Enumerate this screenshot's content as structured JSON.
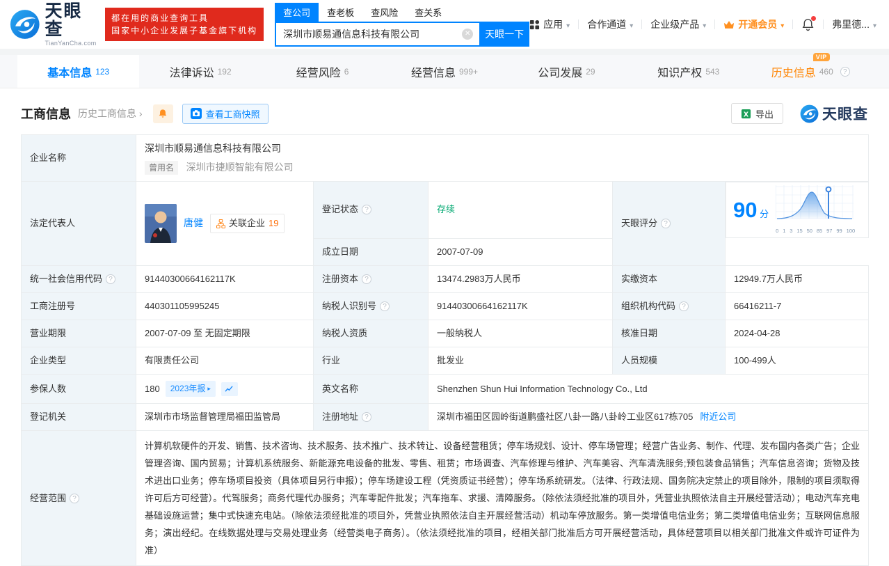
{
  "header": {
    "brand": "天眼查",
    "brand_domain": "TianYanCha.com",
    "slogan_line1": "都在用的商业查询工具",
    "slogan_line2": "国家中小企业发展子基金旗下机构",
    "search_tabs": [
      {
        "label": "查公司"
      },
      {
        "label": "查老板"
      },
      {
        "label": "查风险"
      },
      {
        "label": "查关系"
      }
    ],
    "search_value": "深圳市顺易通信息科技有限公司",
    "search_button": "天眼一下",
    "nav_app": "应用",
    "nav_partner": "合作通道",
    "nav_enterprise": "企业级产品",
    "nav_vip": "开通会员",
    "nav_user": "弗里德..."
  },
  "tabs": [
    {
      "label": "基本信息",
      "count": "123"
    },
    {
      "label": "法律诉讼",
      "count": "192"
    },
    {
      "label": "经营风险",
      "count": "6"
    },
    {
      "label": "经营信息",
      "count": "999+"
    },
    {
      "label": "公司发展",
      "count": "29"
    },
    {
      "label": "知识产权",
      "count": "543"
    },
    {
      "label": "历史信息",
      "count": "460",
      "badge": "VIP"
    }
  ],
  "section": {
    "title": "工商信息",
    "history_link": "历史工商信息",
    "snapshot_button": "查看工商快照",
    "export_button": "导出",
    "watermark_brand": "天眼查"
  },
  "fields": {
    "company_name": {
      "label": "企业名称",
      "value": "深圳市顺易通信息科技有限公司",
      "former_label": "曾用名",
      "former_value": "深圳市捷顺智能有限公司"
    },
    "legal_rep": {
      "label": "法定代表人",
      "name": "唐健",
      "related_label": "关联企业",
      "related_count": "19"
    },
    "reg_status": {
      "label": "登记状态",
      "value": "存续"
    },
    "est_date": {
      "label": "成立日期",
      "value": "2007-07-09"
    },
    "score": {
      "label": "天眼评分"
    },
    "credit_code": {
      "label": "统一社会信用代码",
      "value": "91440300664162117K"
    },
    "reg_capital": {
      "label": "注册资本",
      "value": "13474.2983万人民币"
    },
    "paid_capital": {
      "label": "实缴资本",
      "value": "12949.7万人民币"
    },
    "reg_no": {
      "label": "工商注册号",
      "value": "440301105995245"
    },
    "taxpayer_no": {
      "label": "纳税人识别号",
      "value": "91440300664162117K"
    },
    "org_code": {
      "label": "组织机构代码",
      "value": "66416211-7"
    },
    "term": {
      "label": "营业期限",
      "value": "2007-07-09 至 无固定期限"
    },
    "taxpayer_type": {
      "label": "纳税人资质",
      "value": "一般纳税人"
    },
    "approved": {
      "label": "核准日期",
      "value": "2024-04-28"
    },
    "ent_type": {
      "label": "企业类型",
      "value": "有限责任公司"
    },
    "industry": {
      "label": "行业",
      "value": "批发业"
    },
    "staff": {
      "label": "人员规模",
      "value": "100-499人"
    },
    "insured": {
      "label": "参保人数",
      "value": "180",
      "badge": "2023年报"
    },
    "en_name": {
      "label": "英文名称",
      "value": "Shenzhen Shun Hui Information Technology Co., Ltd"
    },
    "authority": {
      "label": "登记机关",
      "value": "深圳市市场监督管理局福田监管局"
    },
    "address": {
      "label": "注册地址",
      "value": "深圳市福田区园岭街道鹏盛社区八卦一路八卦岭工业区617栋705",
      "nearby_link": "附近公司"
    },
    "scope": {
      "label": "经营范围",
      "value": "计算机软硬件的开发、销售、技术咨询、技术服务、技术推广、技术转让、设备经营租赁；停车场规划、设计、停车场管理；经营广告业务、制作、代理、发布国内各类广告；企业管理咨询、国内贸易；计算机系统服务、新能源充电设备的批发、零售、租赁；市场调查、汽车修理与维护、汽车美容、汽车清洗服务;预包装食品销售；汽车信息咨询；货物及技术进出口业务；停车场项目投资（具体项目另行申报）；停车场建设工程（凭资质证书经营）；停车场系统研发。（法律、行政法规、国务院决定禁止的项目除外，限制的项目须取得许可后方可经营）。代驾服务；商务代理代办服务；汽车零配件批发；汽车拖车、求援、清障服务。（除依法须经批准的项目外，凭营业执照依法自主开展经营活动）；电动汽车充电基础设施运营；集中式快速充电站。（除依法须经批准的项目外，凭营业执照依法自主开展经营活动）机动车停放服务。第一类增值电信业务；第二类增值电信业务；互联网信息服务；演出经纪。在线数据处理与交易处理业务（经营类电子商务）。（依法须经批准的项目，经相关部门批准后方可开展经营活动，具体经营项目以相关部门批准文件或许可证件为准）"
    }
  },
  "score_chart": {
    "type": "area",
    "score": "90",
    "unit": "分",
    "marker_value": 90,
    "ticks": [
      "0",
      "1",
      "3",
      "15",
      "50",
      "85",
      "97",
      "99",
      "100"
    ],
    "curve_color": "#5394e0",
    "accent_color": "#0084ff"
  }
}
